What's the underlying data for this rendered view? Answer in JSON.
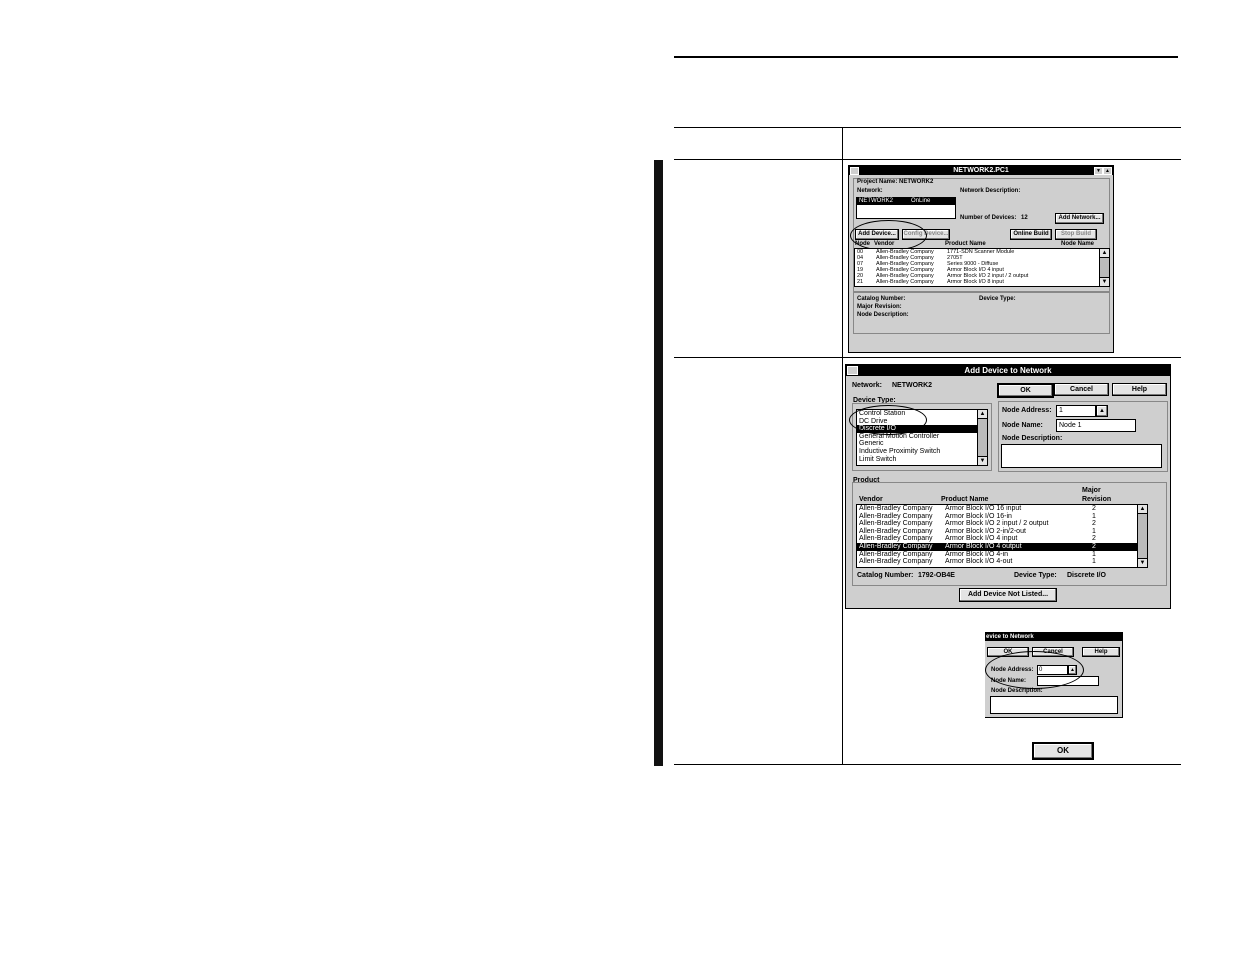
{
  "network_window": {
    "title": "NETWORK2.PC1",
    "project_name_label": "Project Name:",
    "project_name": "NETWORK2",
    "network_label": "Network:",
    "network_row": {
      "name": "NETWORK2",
      "status": "OnLine"
    },
    "network_description_label": "Network Description:",
    "number_of_devices_label": "Number of Devices:",
    "number_of_devices": "12",
    "buttons": {
      "add_network": "Add Network...",
      "add_device": "Add Device...",
      "config_device": "Config Device...",
      "online_build": "Online Build",
      "stop_build": "Stop Build"
    },
    "columns": [
      "Node",
      "Vendor",
      "Product Name",
      "Node Name"
    ],
    "rows": [
      {
        "node": "00",
        "vendor": "Allen-Bradley Company",
        "product": "1771-SDN Scanner Module"
      },
      {
        "node": "04",
        "vendor": "Allen-Bradley Company",
        "product": "2705T"
      },
      {
        "node": "07",
        "vendor": "Allen-Bradley Company",
        "product": "Series 9000 - Diffuse"
      },
      {
        "node": "19",
        "vendor": "Allen-Bradley Company",
        "product": "Armor Block I/O  4 input"
      },
      {
        "node": "20",
        "vendor": "Allen-Bradley Company",
        "product": "Armor Block I/O  2 input / 2 output"
      },
      {
        "node": "21",
        "vendor": "Allen-Bradley Company",
        "product": "Armor Block I/O  8 input"
      }
    ],
    "catalog_number_label": "Catalog Number:",
    "device_type_label": "Device Type:",
    "major_revision_label": "Major Revision:",
    "node_description_label": "Node Description:"
  },
  "add_device_dialog": {
    "title": "Add Device to Network",
    "network_label": "Network:",
    "network_value": "NETWORK2",
    "buttons": {
      "ok": "OK",
      "cancel": "Cancel",
      "help": "Help",
      "add_not_listed": "Add Device Not Listed..."
    },
    "device_type_label": "Device Type:",
    "device_types": [
      "Control Station",
      "DC Drive",
      "Discrete I/O",
      "General Motion Controller",
      "Generic",
      "Inductive Proximity Switch",
      "Limit Switch"
    ],
    "device_type_selected": 2,
    "node_address_label": "Node Address:",
    "node_address_value": "1",
    "node_name_label": "Node Name:",
    "node_name_value": "Node 1",
    "node_description_label": "Node Description:",
    "product_label": "Product",
    "product_columns": {
      "vendor": "Vendor",
      "product_name": "Product Name",
      "major": "Major",
      "revision": "Revision"
    },
    "products": [
      {
        "vendor": "Allen-Bradley Company",
        "product": "Armor Block I/O  16 input",
        "rev": "2"
      },
      {
        "vendor": "Allen-Bradley Company",
        "product": "Armor Block I/O  16-in",
        "rev": "1"
      },
      {
        "vendor": "Allen-Bradley Company",
        "product": "Armor Block I/O  2 input / 2 output",
        "rev": "2"
      },
      {
        "vendor": "Allen-Bradley Company",
        "product": "Armor Block I/O  2-in/2-out",
        "rev": "1"
      },
      {
        "vendor": "Allen-Bradley Company",
        "product": "Armor Block I/O  4 input",
        "rev": "2"
      },
      {
        "vendor": "Allen-Bradley Company",
        "product": "Armor Block I/O  4 output",
        "rev": "2"
      },
      {
        "vendor": "Allen-Bradley Company",
        "product": "Armor Block I/O  4-in",
        "rev": "1"
      },
      {
        "vendor": "Allen-Bradley Company",
        "product": "Armor Block I/O  4-out",
        "rev": "1"
      }
    ],
    "product_selected": 5,
    "catalog_number_label": "Catalog Number:",
    "catalog_number": "1792-OB4E",
    "device_type_value": "Discrete I/O"
  },
  "crop_dialog": {
    "title": "evice to Network",
    "ok": "OK",
    "cancel": "Cancel",
    "help": "Help",
    "node_address_label": "Node Address:",
    "node_address_value": "0",
    "node_name_label": "Node Name:",
    "node_description_label": "Node Description:"
  },
  "standalone_ok": "OK"
}
